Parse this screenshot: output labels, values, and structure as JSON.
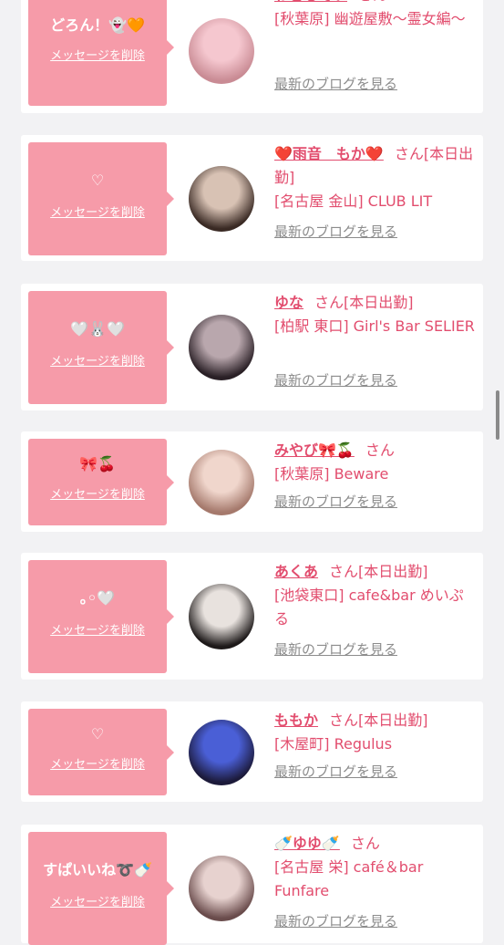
{
  "cards": [
    {
      "message": "どろん！👻🧡",
      "delete_label": "メッセージを削除",
      "name": "わどるでぃ",
      "suffix": "さん",
      "shop": "[秋葉原] 幽遊屋敷〜霊女編〜",
      "blog_label": "最新のブログを見る",
      "avatar_colors": [
        "#f5c7cf",
        "#c98b94"
      ]
    },
    {
      "message": "♡",
      "delete_label": "メッセージを削除",
      "name": "❤️雨音　もか❤️",
      "suffix": "さん[本日出勤]",
      "shop": "[名古屋 金山] CLUB LIT",
      "blog_label": "最新のブログを見る",
      "avatar_colors": [
        "#d8c2b4",
        "#3a2a24"
      ]
    },
    {
      "message": "🤍🐰🤍",
      "delete_label": "メッセージを削除",
      "name": "ゆな",
      "suffix": "さん[本日出勤]",
      "shop": "[柏駅 東口] Girl's Bar SELIER",
      "blog_label": "最新のブログを見る",
      "avatar_colors": [
        "#b9a7ad",
        "#2a2026"
      ]
    },
    {
      "message": "🎀🍒",
      "delete_label": "メッセージを削除",
      "name": "みやび🎀🍒",
      "suffix": "さん",
      "shop": "[秋葉原] Beware",
      "blog_label": "最新のブログを見る",
      "avatar_colors": [
        "#f0d6cc",
        "#a5796c"
      ]
    },
    {
      "message": "｡◦🤍",
      "delete_label": "メッセージを削除",
      "name": "あくあ",
      "suffix": "さん[本日出勤]",
      "shop": "[池袋東口] cafe&bar めいぷる",
      "blog_label": "最新のブログを見る",
      "avatar_colors": [
        "#e8e2de",
        "#1e1a1a"
      ]
    },
    {
      "message": "♡",
      "delete_label": "メッセージを削除",
      "name": "ももか",
      "suffix": "さん[本日出勤]",
      "shop": "[木屋町] Regulus",
      "blog_label": "最新のブログを見る",
      "avatar_colors": [
        "#4a5fd6",
        "#1c1a3a"
      ]
    },
    {
      "message": "すぱいいね➰🍼",
      "delete_label": "メッセージを削除",
      "name": "🍼ゆゆ🍼",
      "suffix": "さん",
      "shop": "[名古屋 栄] café＆bar Funfare",
      "blog_label": "最新のブログを見る",
      "avatar_colors": [
        "#e7d2cf",
        "#6a4c4c"
      ]
    }
  ]
}
